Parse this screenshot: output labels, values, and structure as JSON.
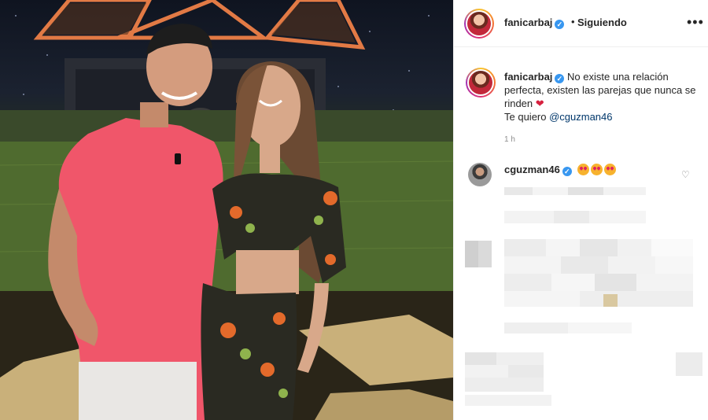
{
  "post": {
    "username": "fanicarbaj",
    "follow_status": "Siguiendo",
    "separator": "•",
    "more_icon": "more-horizontal-icon",
    "caption_line1": "No existe una relación perfecta, existen las parejas que nunca se rinden",
    "caption_emoji": "❤",
    "caption_line2_prefix": "Te quiero ",
    "caption_mention": "@cguzman46",
    "time": "1 h"
  },
  "comment": {
    "username": "cguzman46",
    "like_icon": "heart-outline-icon"
  },
  "colors": {
    "verified": "#3897f0",
    "mention": "#00376b",
    "muted": "#8e8e8e",
    "text": "#262626"
  }
}
